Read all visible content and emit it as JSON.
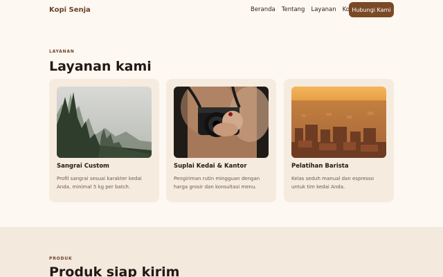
{
  "nav": {
    "logo": "Kopi Senja",
    "links": [
      "Beranda",
      "Tentang",
      "Layanan",
      "Kontak"
    ],
    "cta_label": "Hubungi Kami"
  },
  "services": {
    "eyebrow": "LAYANAN",
    "title": "Layanan kami",
    "cards": [
      {
        "title": "Sangrai Custom",
        "description": "Profil sangrai sesuai karakter kedai Anda, minimal 5 kg per batch."
      },
      {
        "title": "Suplai Kedai & Kantor",
        "description": "Pengiriman rutin mingguan dengan harga grosir dan konsultasi menu."
      },
      {
        "title": "Pelatihan Barista",
        "description": "Kelas seduh manual dan espresso untuk tim kedai Anda."
      }
    ]
  },
  "products": {
    "eyebrow": "PRODUK",
    "title": "Produk siap kirim"
  },
  "colors": {
    "brand": "#7a4a26",
    "background": "#fdf8f2",
    "card": "#f6ebdf"
  }
}
